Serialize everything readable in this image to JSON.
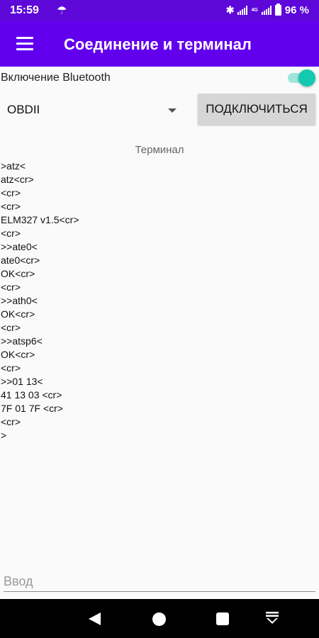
{
  "status_bar": {
    "time": "15:59",
    "umbrella_icon": "umbrella-icon",
    "bluetooth_icon": "bluetooth-icon",
    "network_label": "4G",
    "battery": "96 %"
  },
  "app_bar": {
    "title": "Соединение и терминал",
    "menu_icon": "hamburger-menu-icon"
  },
  "bluetooth": {
    "label": "Включение Bluetooth",
    "enabled": true
  },
  "device_select": {
    "value": "OBDII"
  },
  "connect_button": {
    "label": "ПОДКЛЮЧИТЬСЯ"
  },
  "terminal": {
    "title": "Терминал",
    "lines": [
      ">atz<",
      "atz<cr>",
      "<cr>",
      "<cr>",
      "ELM327 v1.5<cr>",
      "<cr>",
      ">>ate0<",
      "ate0<cr>",
      "OK<cr>",
      "<cr>",
      ">>ath0<",
      "OK<cr>",
      "<cr>",
      ">>atsp6<",
      "OK<cr>",
      "<cr>",
      ">>01 13<",
      "41 13 03 <cr>",
      "7F 01 7F <cr>",
      "<cr>",
      ">"
    ]
  },
  "input": {
    "placeholder": "Ввод",
    "value": ""
  },
  "colors": {
    "status_bar": "#5d07d9",
    "app_bar": "#6200ee",
    "switch_on": "#14c9b0",
    "nav_bar": "#000000"
  }
}
